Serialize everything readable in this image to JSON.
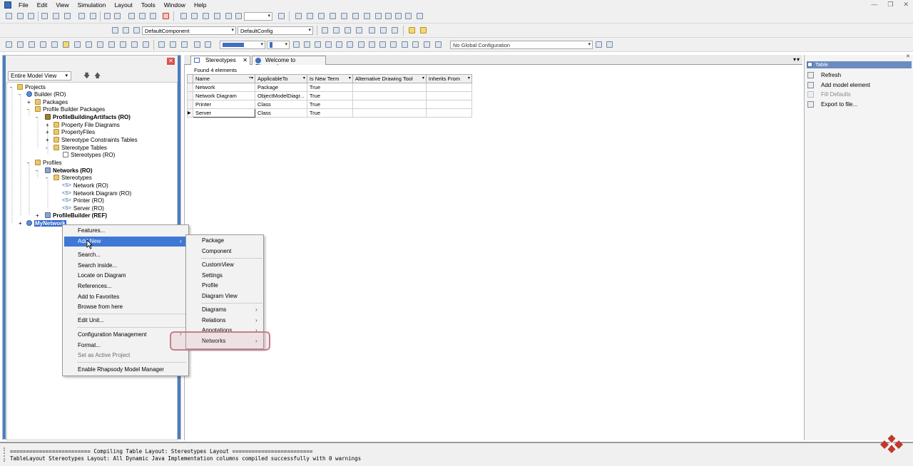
{
  "menubar": {
    "items": [
      "File",
      "Edit",
      "View",
      "Simulation",
      "Layout",
      "Tools",
      "Window",
      "Help"
    ]
  },
  "toolbar2": {
    "component": "DefaultComponent",
    "config": "DefaultConfig"
  },
  "toolbar3": {
    "global_config": "No Global Configuration"
  },
  "left_panel": {
    "view_select": "Entire Model View",
    "tree": [
      {
        "label": "Projects"
      },
      {
        "label": "Builder (RO)"
      },
      {
        "label": "Packages"
      },
      {
        "label": "Profile Builder Packages"
      },
      {
        "label": "ProfileBuildingArtifacts (RO)"
      },
      {
        "label": "Property File Diagrams"
      },
      {
        "label": "PropertyFiles"
      },
      {
        "label": "Stereotype Constraints Tables"
      },
      {
        "label": "Stereotype Tables"
      },
      {
        "label": "Stereotypes (RO)"
      },
      {
        "label": "Profiles"
      },
      {
        "label": "Networks (RO)"
      },
      {
        "label": "Stereotypes"
      },
      {
        "label": "Network (RO)"
      },
      {
        "label": "Network Diagram (RO)"
      },
      {
        "label": "Printer (RO)"
      },
      {
        "label": "Server (RO)"
      },
      {
        "label": "ProfileBuilder (REF)"
      },
      {
        "label": "MyNetwork"
      }
    ]
  },
  "tabs": [
    {
      "label": "Stereotypes"
    },
    {
      "label": "Welcome to Rhapsody"
    }
  ],
  "table": {
    "found_text": "Found  4  elements",
    "columns": [
      "Name",
      "ApplicableTo",
      "Is New Term",
      "Alternative Drawing Tool",
      "Inherits From"
    ],
    "rows": [
      [
        "Network",
        "Package",
        "True",
        "",
        ""
      ],
      [
        "Network Diagram",
        "ObjectModelDiagr...",
        "True",
        "",
        ""
      ],
      [
        "Printer",
        "Class",
        "True",
        "",
        ""
      ],
      [
        "Server",
        "Class",
        "True",
        "",
        ""
      ]
    ]
  },
  "right_panel": {
    "header": "Table",
    "items": [
      "Refresh",
      "Add model element",
      "Fill Defaults",
      "Export to file..."
    ]
  },
  "context_menu": {
    "items": [
      "Features...",
      "Add New",
      "Search...",
      "Search inside...",
      "Locate on Diagram",
      "References...",
      "Add to Favorites",
      "Browse from here",
      "Edit Unit...",
      "Configuration Management",
      "Format...",
      "Set as Active Project",
      "Enable Rhapsody Model Manager"
    ]
  },
  "submenu": {
    "items": [
      "Package",
      "Component",
      "CustomView",
      "Settings",
      "Profile",
      "Diagram View",
      "Diagrams",
      "Relations",
      "Annotations",
      "Networks"
    ]
  },
  "output": {
    "line1": "========================= Compiling Table Layout: Stereotypes Layout =========================",
    "line2": "TableLayout Stereotypes Layout: All Dynamic Java Implementation columns compiled successfully with 0 warnings"
  },
  "colors": {
    "accent": "#3f78d4",
    "highlight_box": "#c77d8c",
    "logo": "#c0392b"
  }
}
